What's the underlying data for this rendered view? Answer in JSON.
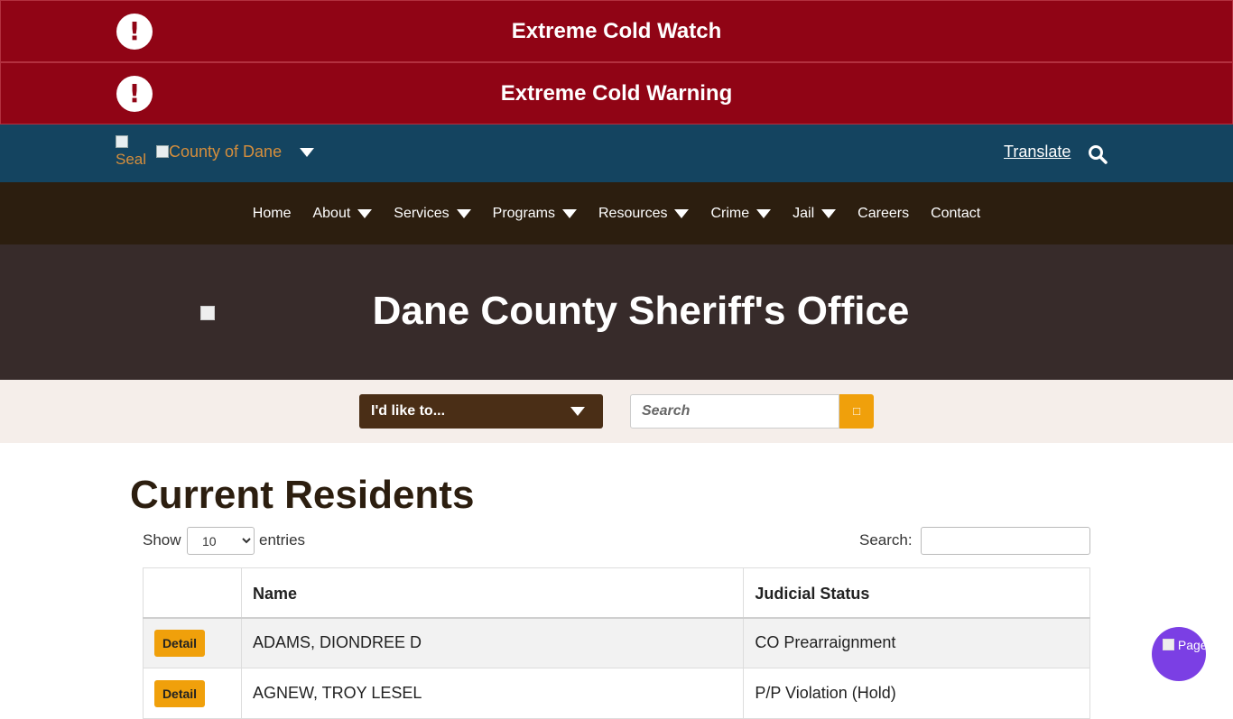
{
  "alerts": [
    {
      "text": "Extreme Cold Watch",
      "icon": "exclamation-circle-icon",
      "glyph": "!"
    },
    {
      "text": "Extreme Cold Warning",
      "icon": "exclamation-circle-icon",
      "glyph": "!"
    }
  ],
  "header": {
    "seal_alt": "Seal",
    "logo_alt": "County of Dane",
    "translate_label": "Translate",
    "search_icon": "search-icon"
  },
  "nav": {
    "items": [
      {
        "label": "Home",
        "dropdown": false
      },
      {
        "label": "About",
        "dropdown": true
      },
      {
        "label": "Services",
        "dropdown": true
      },
      {
        "label": "Programs",
        "dropdown": true
      },
      {
        "label": "Resources",
        "dropdown": true
      },
      {
        "label": "Crime",
        "dropdown": true
      },
      {
        "label": "Jail",
        "dropdown": true
      },
      {
        "label": "Careers",
        "dropdown": false
      },
      {
        "label": "Contact",
        "dropdown": false
      }
    ]
  },
  "hero": {
    "title": "Dane County Sheriff's Office"
  },
  "toolbar": {
    "like_to_label": "I'd like to...",
    "search_placeholder": "Search",
    "search_button_glyph": "□"
  },
  "main": {
    "heading": "Current Residents",
    "length_prefix": "Show",
    "length_value": "10",
    "length_suffix": "entries",
    "filter_label": "Search:"
  },
  "table": {
    "columns": [
      "",
      "Name",
      "Judicial Status"
    ],
    "rows": [
      {
        "action": "Detail",
        "name": "ADAMS, DIONDREE D",
        "status": "CO Prearraignment"
      },
      {
        "action": "Detail",
        "name": "AGNEW, TROY LESEL",
        "status": "P/P Violation (Hold)"
      }
    ]
  },
  "chat": {
    "alt_text": "Page Personalization"
  },
  "colors": {
    "alert_bg": "#900415",
    "topbar_bg": "#144460",
    "nav_bg": "#2c1e0f",
    "hero_bg": "#372b2a",
    "accent": "#f0a00b",
    "chat_bg": "#7b3fe4"
  }
}
